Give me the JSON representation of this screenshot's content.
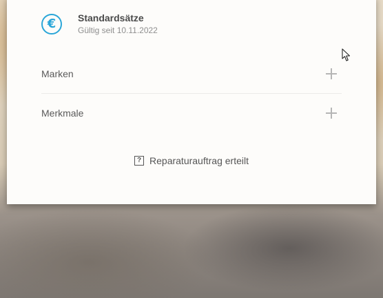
{
  "header": {
    "icon": "euro-icon",
    "title": "Standardsätze",
    "subtitle": "Gültig seit 10.11.2022"
  },
  "sections": [
    {
      "label": "Marken",
      "icon": "plus-icon"
    },
    {
      "label": "Merkmale",
      "icon": "plus-icon"
    }
  ],
  "footer": {
    "icon": "question-mark-icon",
    "label": "Reparaturauftrag erteilt"
  },
  "colors": {
    "accent": "#2aa6d8",
    "text": "#5a5a5a",
    "muted": "#8f8f8f",
    "card": "#fdfcfa"
  }
}
